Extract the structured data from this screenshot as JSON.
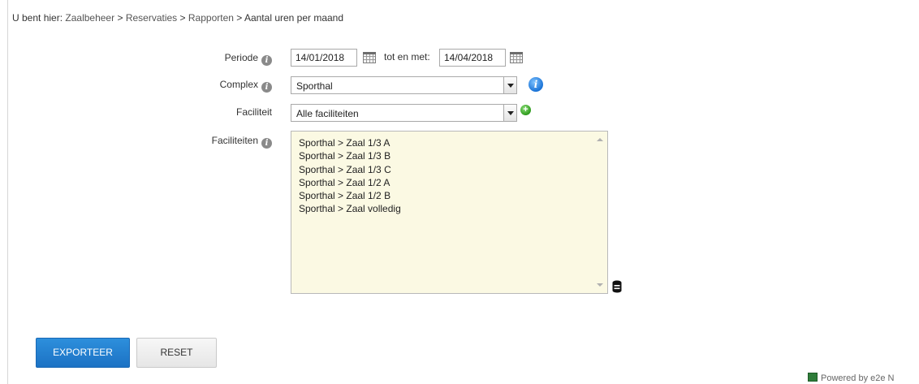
{
  "breadcrumb": {
    "prefix": "U bent hier:",
    "items": [
      "Zaalbeheer",
      "Reservaties",
      "Rapporten",
      "Aantal uren per maand"
    ],
    "separator": ">"
  },
  "form": {
    "periode_label": "Periode",
    "date_from": "14/01/2018",
    "date_to_label": "tot en met:",
    "date_to": "14/04/2018",
    "complex_label": "Complex",
    "complex_value": "Sporthal",
    "faciliteit_label": "Faciliteit",
    "faciliteit_value": "Alle faciliteiten",
    "faciliteiten_label": "Faciliteiten",
    "faciliteiten_items": [
      "Sporthal > Zaal 1/3 A",
      "Sporthal > Zaal 1/3 B",
      "Sporthal > Zaal 1/3 C",
      "Sporthal > Zaal 1/2 A",
      "Sporthal > Zaal 1/2 B",
      "Sporthal > Zaal volledig"
    ]
  },
  "buttons": {
    "export_label": "EXPORTEER",
    "reset_label": "RESET"
  },
  "footer": {
    "powered_text": "Powered by e2e N"
  },
  "icons": {
    "info": "info-icon",
    "calendar": "calendar-icon",
    "complex_info": "info-circle-icon",
    "add": "plus-circle-icon",
    "database": "database-icon"
  },
  "colors": {
    "primary_button": "#1f78c9",
    "listbox_background": "#fbf9e3",
    "info_blue": "#1a73d6",
    "add_green": "#2d9a1c"
  }
}
